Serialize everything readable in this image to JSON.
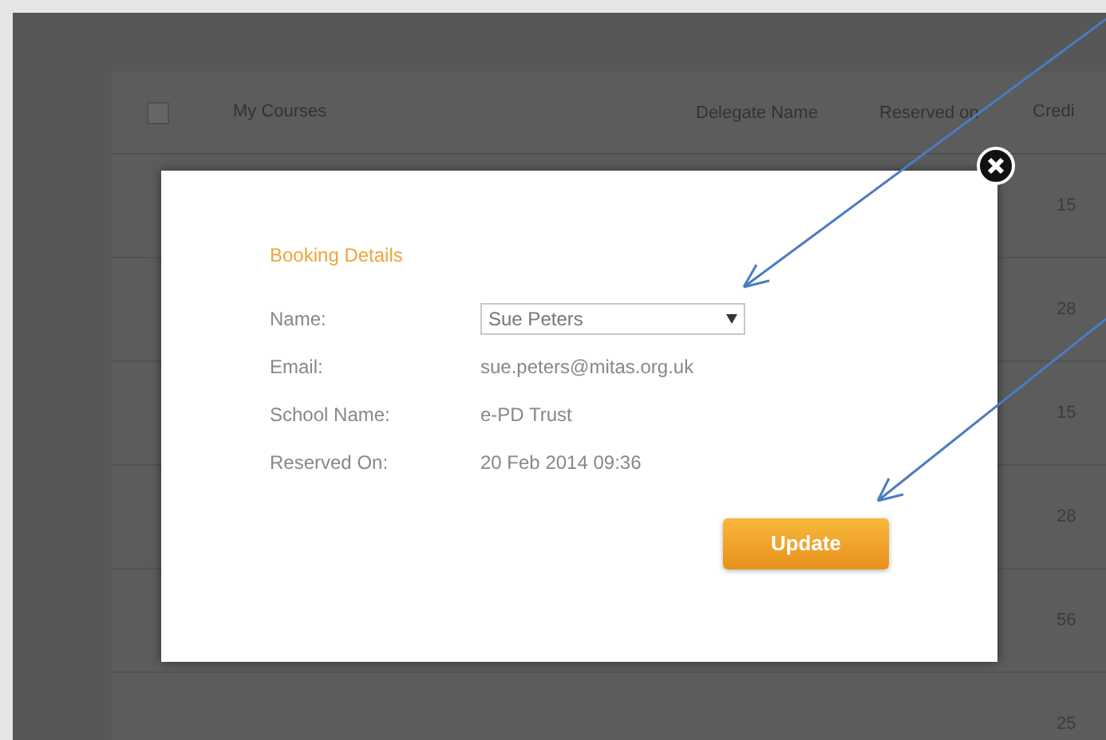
{
  "table": {
    "select_all": {
      "checked": false
    },
    "columns": [
      "My Courses",
      "Delegate Name",
      "Reserved on",
      "Credi"
    ],
    "rows": [
      {
        "credits": "15"
      },
      {
        "credits": "28"
      },
      {
        "credits": "15"
      },
      {
        "credits": "28"
      },
      {
        "credits": "56"
      },
      {
        "credits": "25"
      }
    ]
  },
  "dialog": {
    "title": "Booking Details",
    "fields": [
      {
        "kind": "select",
        "label": "Name:",
        "value": "Sue Peters"
      },
      {
        "kind": "text",
        "label": "Email:",
        "value": "sue.peters@mitas.org.uk"
      },
      {
        "kind": "text",
        "label": "School Name:",
        "value": "e-PD Trust"
      },
      {
        "kind": "text",
        "label": "Reserved On:",
        "value": "20 Feb 2014 09:36"
      }
    ],
    "button": "Update"
  }
}
